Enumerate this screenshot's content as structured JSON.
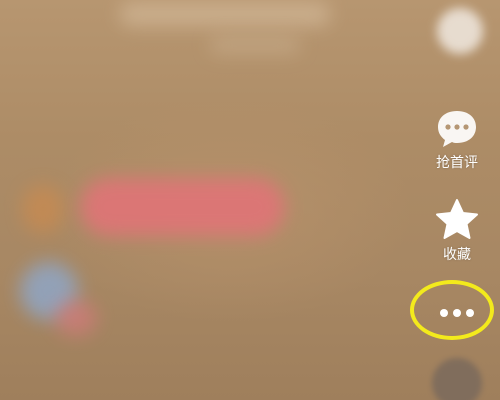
{
  "side_actions": {
    "comment": {
      "label": "抢首评",
      "icon": "comment-bubble-icon"
    },
    "favorite": {
      "label": "收藏",
      "icon": "star-icon"
    },
    "more": {
      "icon": "more-dots-icon"
    }
  },
  "colors": {
    "background": "#a98963",
    "icon": "#ffffff",
    "highlight": "#f3ea1c",
    "blurred_banner": "#e07477"
  }
}
